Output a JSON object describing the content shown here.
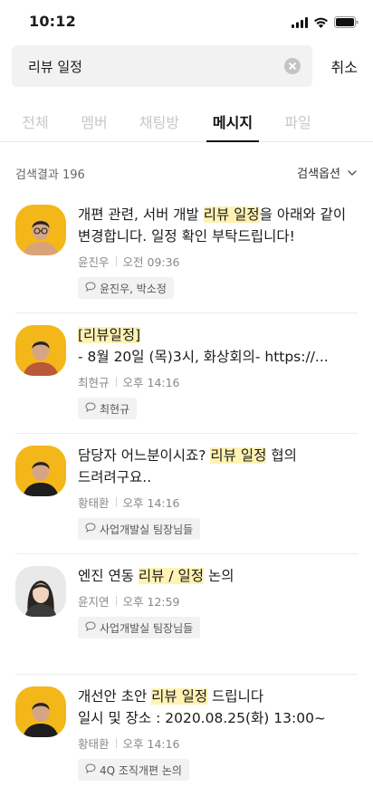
{
  "status": {
    "time": "10:12"
  },
  "search": {
    "query": "리뷰 일정",
    "cancel_label": "취소"
  },
  "tabs": [
    {
      "label": "전체"
    },
    {
      "label": "멤버"
    },
    {
      "label": "채팅방"
    },
    {
      "label": "메시지",
      "active": true
    },
    {
      "label": "파일"
    }
  ],
  "results": {
    "count_label": "검색결과 196",
    "options_label": "검색옵션",
    "items": [
      {
        "text_parts": [
          {
            "text": "개편 관련, 서버 개발 "
          },
          {
            "text": "리뷰 일정",
            "highlight": true
          },
          {
            "text": "을 아래와 같이 변경합니다. 일정 확인 부탁드립니다!"
          }
        ],
        "sender": "윤진우",
        "time": "오전 09:36",
        "room": "윤진우, 박소정",
        "avatar": {
          "bg": "#f4b71a",
          "style": "man-glasses"
        }
      },
      {
        "text_parts": [
          {
            "text": "[리뷰일정]",
            "highlight": true
          },
          {
            "text": "\n- 8월 20일 (목)3시, 화상회의- https://..."
          }
        ],
        "sender": "최현규",
        "time": "오후 14:16",
        "room": "최현규",
        "avatar": {
          "bg": "#f4b71a",
          "style": "man-short"
        }
      },
      {
        "text_parts": [
          {
            "text": "담당자 어느분이시죠? "
          },
          {
            "text": "리뷰 일정",
            "highlight": true
          },
          {
            "text": " 협의 드려려구요.."
          }
        ],
        "sender": "황태환",
        "time": "오후 14:16",
        "room": "사업개발실 팀장님들",
        "avatar": {
          "bg": "#f4b71a",
          "style": "man-black"
        }
      },
      {
        "text_parts": [
          {
            "text": "엔진 연동 "
          },
          {
            "text": "리뷰 / 일정",
            "highlight": true
          },
          {
            "text": " 논의"
          }
        ],
        "sender": "윤지연",
        "time": "오후 12:59",
        "room": "사업개발실 팀장님들",
        "avatar": {
          "bg": "#e9e9e9",
          "style": "woman"
        }
      },
      {
        "text_parts": [
          {
            "text": "개선안 초안 "
          },
          {
            "text": "리뷰 일정",
            "highlight": true
          },
          {
            "text": " 드립니다\n일시 및 장소 : 2020.08.25(화) 13:00~"
          }
        ],
        "sender": "황태환",
        "time": "오후 14:16",
        "room": "4Q 조직개편 논의",
        "avatar": {
          "bg": "#f4b71a",
          "style": "man-black"
        }
      }
    ]
  }
}
